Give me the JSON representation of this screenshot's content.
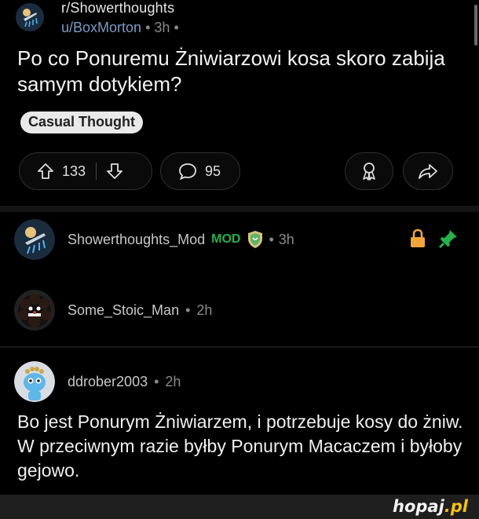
{
  "post": {
    "subreddit": "r/Showerthoughts",
    "author": "u/BoxMorton",
    "age": "3h",
    "title": "Po co Ponuremu Żniwiarzowi kosa skoro zabija samym dotykiem?",
    "flair": "Casual Thought",
    "upvotes": "133",
    "comments": "95"
  },
  "comments": [
    {
      "author": "Showerthoughts_Mod",
      "badge": "MOD",
      "age": "3h"
    },
    {
      "author": "Some_Stoic_Man",
      "age": "2h"
    },
    {
      "author": "ddrober2003",
      "age": "2h",
      "body": "Bo jest Ponurym Żniwiarzem, i potrzebuje kosy do żniw. W przeciwnym razie byłby Ponurym Macaczem i byłoby gejowo."
    }
  ],
  "watermark": {
    "name": "hopaj",
    "domain": ".pl"
  },
  "colors": {
    "background": "#000000",
    "username_link": "#7d9ac4",
    "mod_green": "#28b04b",
    "lock": "#f2a53a",
    "pin": "#28b04b"
  },
  "icons": [
    "subreddit-avatar-icon",
    "upvote-icon",
    "downvote-icon",
    "comment-icon",
    "award-icon",
    "share-icon",
    "mod-shield-icon",
    "lock-icon",
    "pin-icon"
  ]
}
